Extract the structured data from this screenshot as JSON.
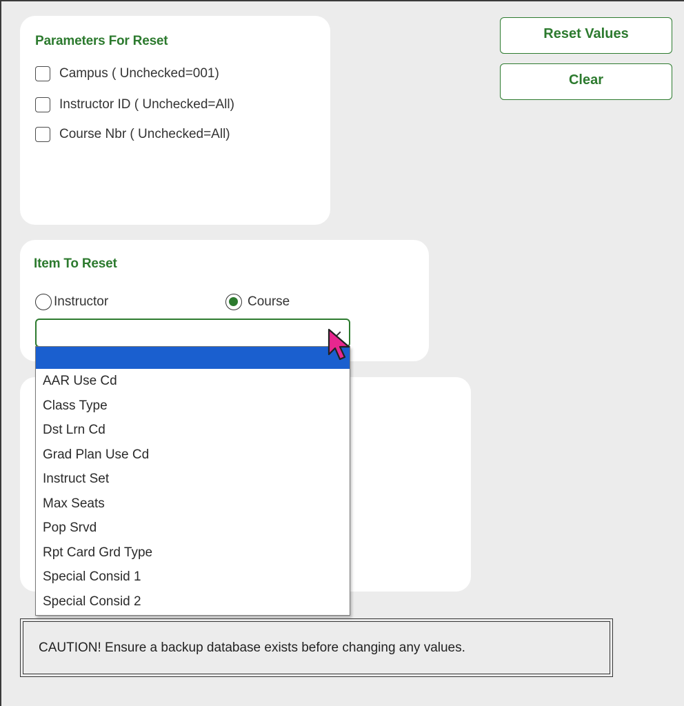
{
  "params_panel": {
    "title": "Parameters For Reset",
    "options": [
      {
        "label": "Campus ( Unchecked=001)",
        "checked": false
      },
      {
        "label": "Instructor ID ( Unchecked=All)",
        "checked": false
      },
      {
        "label": "Course Nbr ( Unchecked=All)",
        "checked": false
      }
    ]
  },
  "actions": {
    "reset_label": "Reset Values",
    "clear_label": "Clear"
  },
  "item_panel": {
    "title": "Item To Reset",
    "radio_instructor": "Instructor",
    "radio_course": "Course",
    "selected_radio": "Course",
    "select_value": ""
  },
  "dropdown": {
    "options": [
      "AAR Use Cd",
      "Class Type",
      "Dst Lrn Cd",
      "Grad Plan Use Cd",
      "Instruct Set",
      "Max Seats",
      "Pop Srvd",
      "Rpt Card Grd Type",
      "Special Consid 1",
      "Special Consid 2"
    ]
  },
  "caution": {
    "text": "CAUTION! Ensure a backup database exists before changing any values."
  },
  "colors": {
    "accent_green": "#2c7a2e",
    "selection_blue": "#1a5fcf",
    "background": "#ececec",
    "cursor_magenta": "#e8278f"
  },
  "icons": {
    "pointer": "mouse-pointer-icon",
    "chevron": "chevron-down-icon"
  }
}
